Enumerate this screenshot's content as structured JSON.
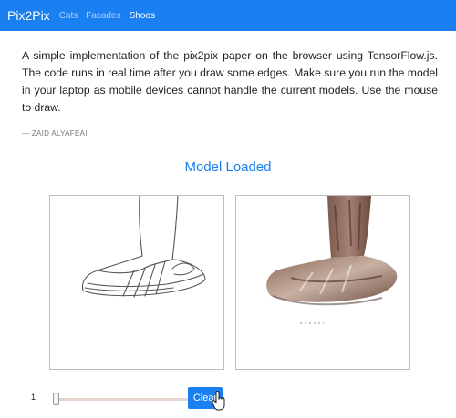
{
  "navbar": {
    "brand": "Pix2Pix",
    "links": [
      {
        "label": "Cats",
        "active": false
      },
      {
        "label": "Facades",
        "active": false
      },
      {
        "label": "Shoes",
        "active": true
      }
    ]
  },
  "intro": {
    "text": "A simple implementation of the pix2pix paper on the browser using TensorFlow.js. The code runs in real time after you draw some edges. Make sure you run the model in your laptop as mobile devices cannot handle the current models. Use the mouse to draw.",
    "author": "— ZAID ALYAFEAI"
  },
  "status": "Model Loaded",
  "controls": {
    "slider_value": "1",
    "clear_label": "Clear"
  },
  "colors": {
    "accent": "#1a7ff0",
    "nav_link_inactive": "#a9d0fb"
  },
  "icons": {
    "cursor": "hand-pointer-icon"
  }
}
